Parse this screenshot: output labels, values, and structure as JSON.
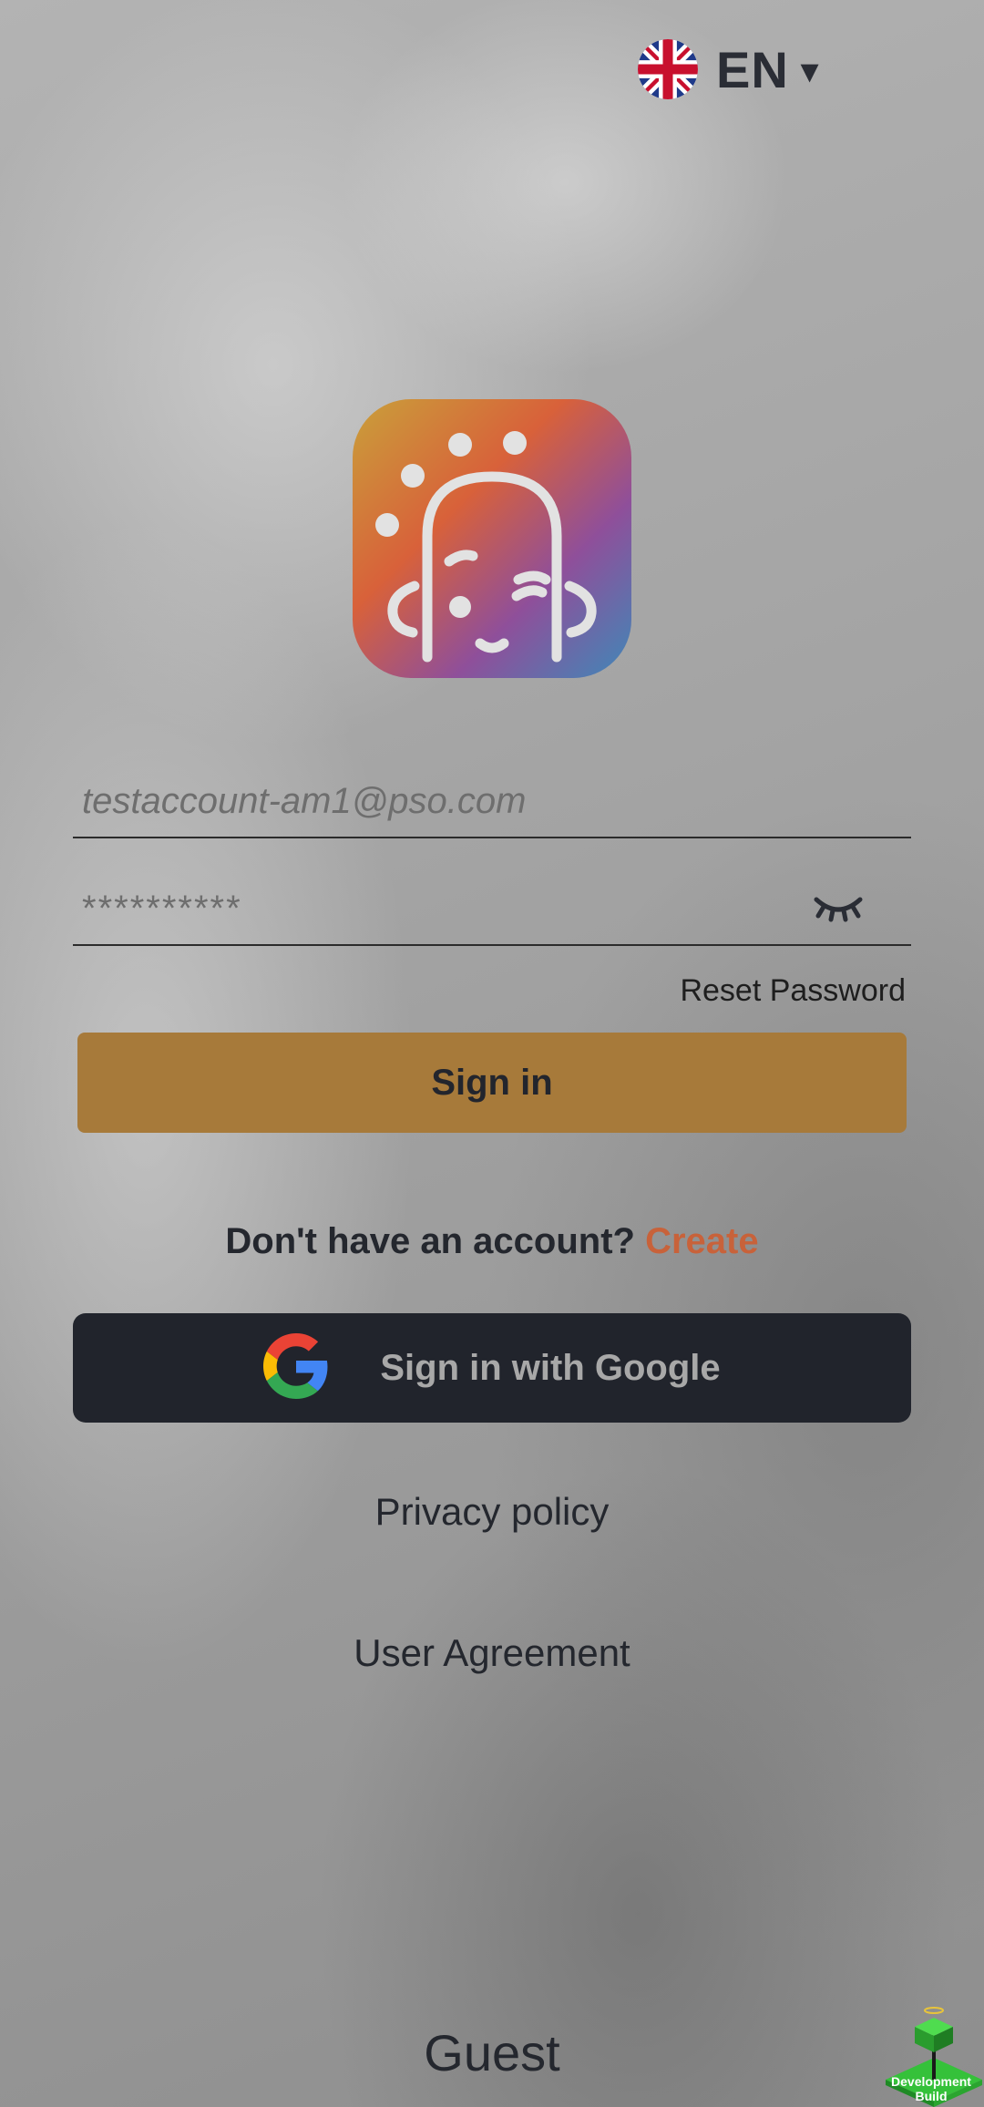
{
  "language": {
    "code": "EN",
    "caret_icon": "caret-down-icon",
    "flag_icon": "uk-flag-icon"
  },
  "logo": {
    "icon": "app-logo-icon",
    "gradient_colors": [
      "#c9a03a",
      "#d8613a",
      "#8f4f9a",
      "#3f88b8"
    ]
  },
  "login": {
    "email_placeholder": "testaccount-am1@pso.com",
    "password_placeholder": "**********",
    "password_toggle_icon": "eye-closed-icon",
    "reset_password": "Reset Password",
    "sign_in": "Sign in"
  },
  "signup": {
    "prompt": "Don't have an account? ",
    "create": "Create"
  },
  "google": {
    "label": "Sign in with Google",
    "icon": "google-icon"
  },
  "links": {
    "privacy": "Privacy policy",
    "agreement": "User Agreement",
    "guest": "Guest"
  },
  "dev_build": {
    "label": "Development Build",
    "icon": "development-build-icon"
  },
  "colors": {
    "sign_in_button": "#a77a3a",
    "create_link": "#c8623a",
    "google_button": "#21242c",
    "text": "#24272e"
  }
}
